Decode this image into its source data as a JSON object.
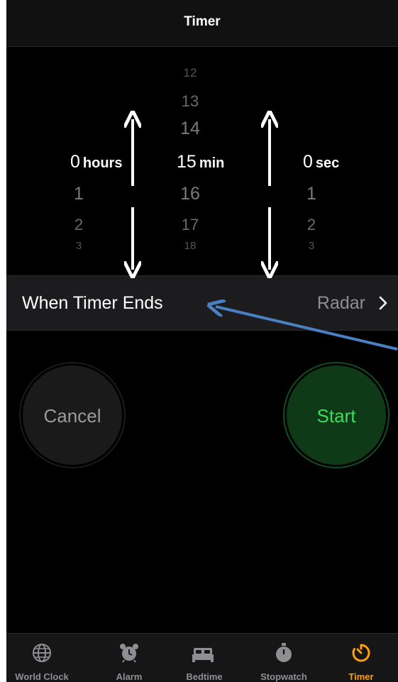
{
  "header": {
    "title": "Timer"
  },
  "picker": {
    "hours": {
      "above": [],
      "selected": "0",
      "unit": "hours",
      "below": [
        "1",
        "2",
        "3"
      ]
    },
    "minutes": {
      "above": [
        "12",
        "13",
        "14"
      ],
      "selected": "15",
      "unit": "min",
      "below": [
        "16",
        "17",
        "18"
      ]
    },
    "seconds": {
      "above": [],
      "selected": "0",
      "unit": "sec",
      "below": [
        "1",
        "2",
        "3"
      ]
    }
  },
  "when_timer_ends": {
    "label": "When Timer Ends",
    "value": "Radar"
  },
  "buttons": {
    "cancel": "Cancel",
    "start": "Start"
  },
  "tabbar": {
    "items": [
      {
        "label": "World Clock",
        "icon": "globe-icon",
        "active": false
      },
      {
        "label": "Alarm",
        "icon": "alarm-clock-icon",
        "active": false
      },
      {
        "label": "Bedtime",
        "icon": "bed-icon",
        "active": false
      },
      {
        "label": "Stopwatch",
        "icon": "stopwatch-icon",
        "active": false
      },
      {
        "label": "Timer",
        "icon": "timer-icon",
        "active": true
      }
    ]
  },
  "colors": {
    "accent_active_tab": "#ff9f0a",
    "start_green": "#3ddc5e",
    "annotation_arrow_blue": "#4a7fc1"
  }
}
